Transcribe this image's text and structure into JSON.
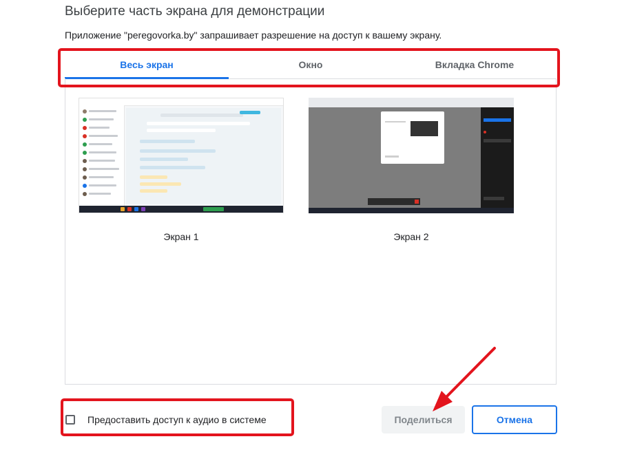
{
  "dialog": {
    "title": "Выберите часть экрана для демонстрации",
    "subtitle": "Приложение \"peregovorka.by\" запрашивает разрешение на доступ к вашему экрану."
  },
  "tabs": [
    {
      "label": "Весь экран",
      "active": true
    },
    {
      "label": "Окно",
      "active": false
    },
    {
      "label": "Вкладка Chrome",
      "active": false
    }
  ],
  "screens": [
    {
      "label": "Экран 1"
    },
    {
      "label": "Экран 2"
    }
  ],
  "audio_checkbox": {
    "label": "Предоставить доступ к аудио в системе",
    "checked": false
  },
  "buttons": {
    "share": "Поделиться",
    "cancel": "Отмена"
  },
  "colors": {
    "accent": "#1a73e8",
    "annotation": "#e3141d"
  }
}
